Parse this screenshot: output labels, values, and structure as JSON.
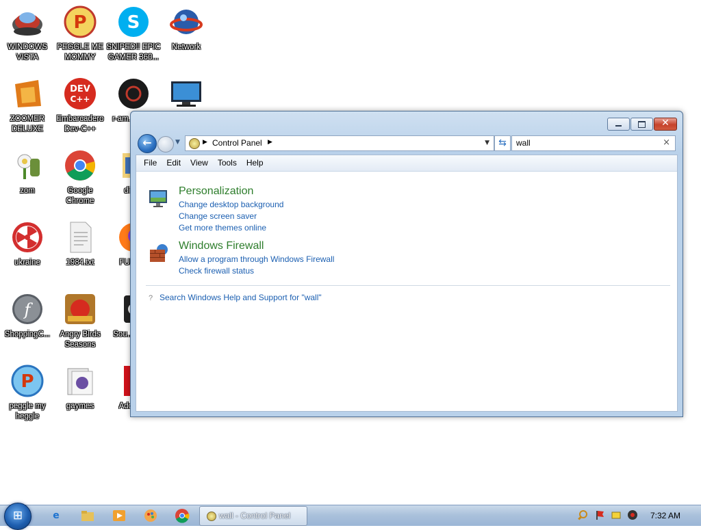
{
  "desktop": {
    "icons": [
      {
        "label": "WINDOWS VISTA"
      },
      {
        "label": "PEGGLE ME MOMMY"
      },
      {
        "label": "SNIPED!! EPIC GAMER 360..."
      },
      {
        "label": "Network"
      },
      {
        "label": "ZOOMER DELUXE"
      },
      {
        "label": "Embarcadero Dev-C++"
      },
      {
        "label": "r-am... par..."
      },
      {
        "label": "zom"
      },
      {
        "label": "Google Chrome"
      },
      {
        "label": "digi..."
      },
      {
        "label": "ukraine"
      },
      {
        "label": "1984.txt"
      },
      {
        "label": "FURR..."
      },
      {
        "label": "ShoppingC..."
      },
      {
        "label": "Angry Birds Seasons"
      },
      {
        "label": "Sou... Pla..."
      },
      {
        "label": "peggle my heggle"
      },
      {
        "label": "gaymes"
      },
      {
        "label": "Adobe..."
      }
    ]
  },
  "window": {
    "address": {
      "crumb": "Control Panel"
    },
    "search": {
      "value": "wall"
    },
    "menu": [
      "File",
      "Edit",
      "View",
      "Tools",
      "Help"
    ],
    "results": [
      {
        "title": "Personalization",
        "icon": "personalization-icon",
        "links": [
          "Change desktop background",
          "Change screen saver",
          "Get more themes online"
        ]
      },
      {
        "title": "Windows Firewall",
        "icon": "firewall-icon",
        "links": [
          "Allow a program through Windows Firewall",
          "Check firewall status"
        ]
      }
    ],
    "help_link": "Search Windows Help and Support for \"wall\""
  },
  "taskbar": {
    "active_task": "wall - Control Panel",
    "clock": "7:32 AM",
    "pinned": [
      "internet-explorer-icon",
      "explorer-icon",
      "media-player-icon",
      "paint-icon",
      "chrome-icon"
    ]
  }
}
